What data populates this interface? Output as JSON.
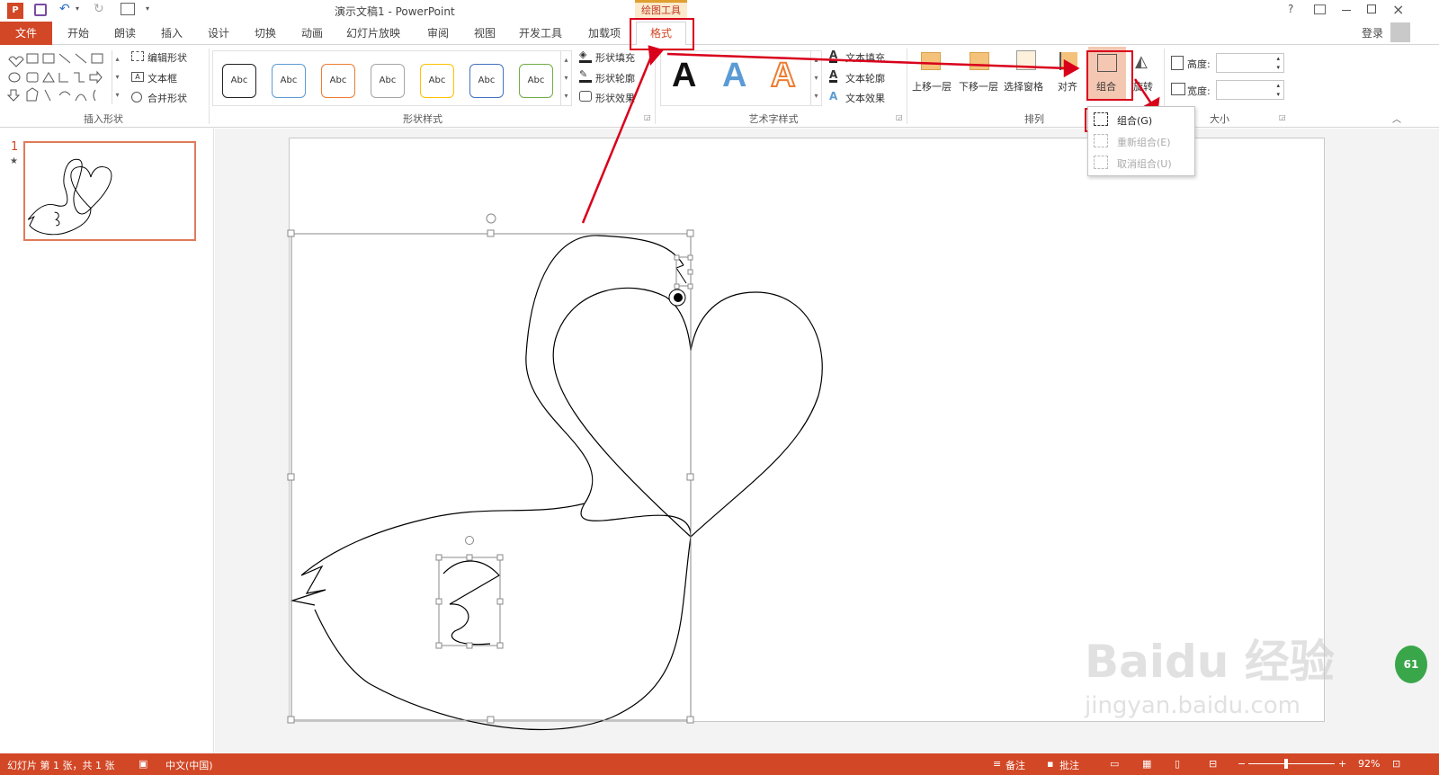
{
  "title_bar": {
    "document_title": "演示文稿1 - PowerPoint",
    "contextual_tab_group": "绘图工具",
    "help": "?",
    "login": "登录"
  },
  "tabs": {
    "file": "文件",
    "items": [
      "开始",
      "朗读",
      "插入",
      "设计",
      "切换",
      "动画",
      "幻灯片放映",
      "审阅",
      "视图",
      "开发工具",
      "加载项",
      "格式"
    ],
    "active": "格式"
  },
  "ribbon": {
    "insert_shapes": {
      "label": "插入形状",
      "edit_shape": "编辑形状",
      "text_box": "文本框",
      "merge_shapes": "合并形状"
    },
    "shape_styles": {
      "label": "形状样式",
      "swatch_text": "Abc",
      "fill": "形状填充",
      "outline": "形状轮廓",
      "effects": "形状效果"
    },
    "wordart_styles": {
      "label": "艺术字样式",
      "glyph": "A",
      "text_fill": "文本填充",
      "text_outline": "文本轮廓",
      "text_effects": "文本效果"
    },
    "arrange": {
      "label": "排列",
      "bring_forward": "上移一层",
      "send_backward": "下移一层",
      "selection_pane": "选择窗格",
      "align": "对齐",
      "group": "组合",
      "rotate": "旋转"
    },
    "size": {
      "label": "大小",
      "height_label": "高度:",
      "width_label": "宽度:",
      "height_value": "",
      "width_value": ""
    }
  },
  "group_menu": {
    "items": [
      {
        "label": "组合(G)",
        "enabled": true
      },
      {
        "label": "重新组合(E)",
        "enabled": false
      },
      {
        "label": "取消组合(U)",
        "enabled": false
      }
    ]
  },
  "thumbnails": {
    "slide_number": "1",
    "star": "★"
  },
  "status_bar": {
    "slide_info": "幻灯片 第 1 张，共 1 张",
    "language": "中文(中国)",
    "notes": "备注",
    "comments": "批注",
    "zoom": "92%"
  },
  "watermark": {
    "brand": "Baidu 经验",
    "url": "jingyan.baidu.com",
    "badge": "61"
  },
  "colors": {
    "accent": "#d24726",
    "annotation_red": "#d9001b",
    "contextual": "#e0a030"
  }
}
